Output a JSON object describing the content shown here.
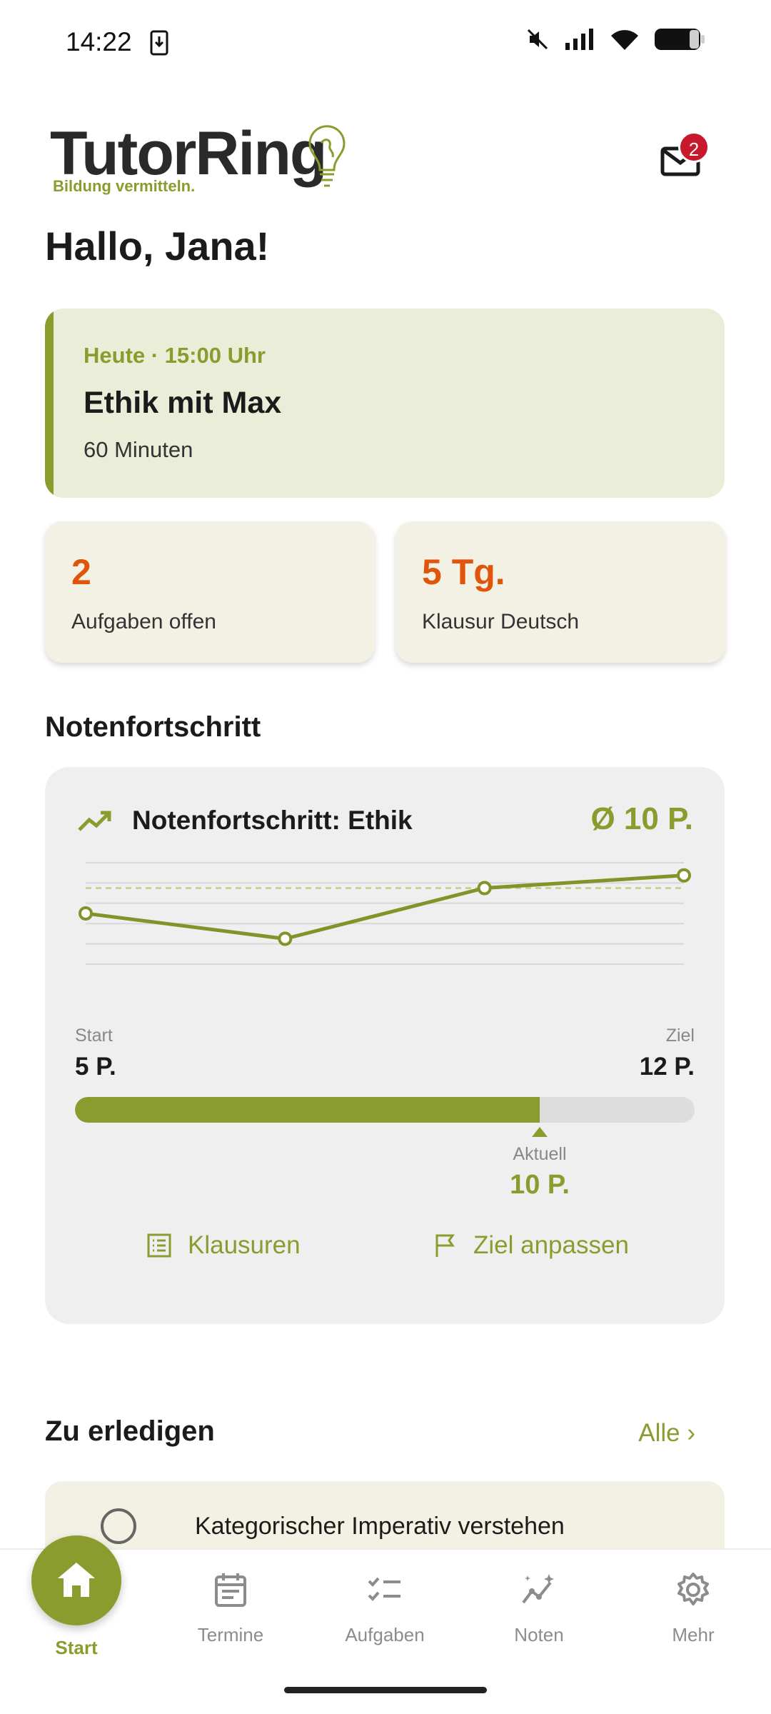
{
  "status_bar": {
    "time": "14:22",
    "icons": [
      "download-icon",
      "mute-icon",
      "signal-icon",
      "wifi-icon",
      "battery-icon"
    ]
  },
  "header": {
    "logo_text": "TutorRing",
    "logo_tagline": "Bildung vermitteln.",
    "mail_badge": "2"
  },
  "greeting": "Hallo, Jana!",
  "appointment": {
    "when": "Heute · 15:00 Uhr",
    "title": "Ethik mit Max",
    "duration": "60 Minuten"
  },
  "stats": [
    {
      "value": "2",
      "label": "Aufgaben offen"
    },
    {
      "value": "5 Tg.",
      "label": "Klausur Deutsch"
    }
  ],
  "progress_section": {
    "heading": "Notenfortschritt",
    "card_title": "Notenfortschritt: Ethik",
    "average": "Ø 10 P.",
    "start_label": "Start",
    "start_value": "5 P.",
    "goal_label": "Ziel",
    "goal_value": "12 P.",
    "current_label": "Aktuell",
    "current_value": "10 P.",
    "progress_fraction": 0.75,
    "action_exams": "Klausuren",
    "action_goal": "Ziel anpassen"
  },
  "chart_data": {
    "type": "line",
    "series": [
      {
        "values": [
          8,
          6,
          10,
          11
        ]
      }
    ],
    "target_line": 10,
    "ylim": [
      4,
      12
    ],
    "grid": true
  },
  "todo": {
    "heading": "Zu erledigen",
    "all_link": "Alle ›",
    "items": [
      {
        "text": "Kategorischer Imperativ verstehen"
      }
    ]
  },
  "nav": [
    {
      "label": "Start",
      "icon": "home-icon",
      "active": true
    },
    {
      "label": "Termine",
      "icon": "calendar-icon"
    },
    {
      "label": "Aufgaben",
      "icon": "tasks-icon"
    },
    {
      "label": "Noten",
      "icon": "grades-icon"
    },
    {
      "label": "Mehr",
      "icon": "gear-icon"
    }
  ],
  "colors": {
    "accent": "#8a9c2e",
    "warning": "#e0550b",
    "badge": "#c8182b"
  }
}
